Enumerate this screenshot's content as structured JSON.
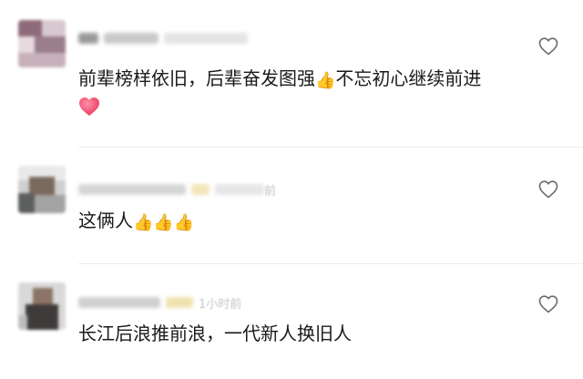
{
  "comments": [
    {
      "time_suffix": "",
      "text": "前辈榜样依旧，后辈奋发图强",
      "thumbs": "👍",
      "text_after": "不忘初心继续前进",
      "heart": "❤"
    },
    {
      "time_suffix": "前",
      "text": "这俩人",
      "thumbs": "👍👍👍"
    },
    {
      "time_suffix": "1小时前",
      "text": "长江后浪推前浪，一代新人换旧人"
    }
  ],
  "icons": {
    "like": "heart-outline-icon",
    "heart_emoji": "red-heart-icon",
    "thumbs": "thumbs-up-icon"
  },
  "colors": {
    "text": "#1a1a1a",
    "time": "#c4c4c4",
    "divider": "#ededed",
    "heart": "#f0506e"
  }
}
